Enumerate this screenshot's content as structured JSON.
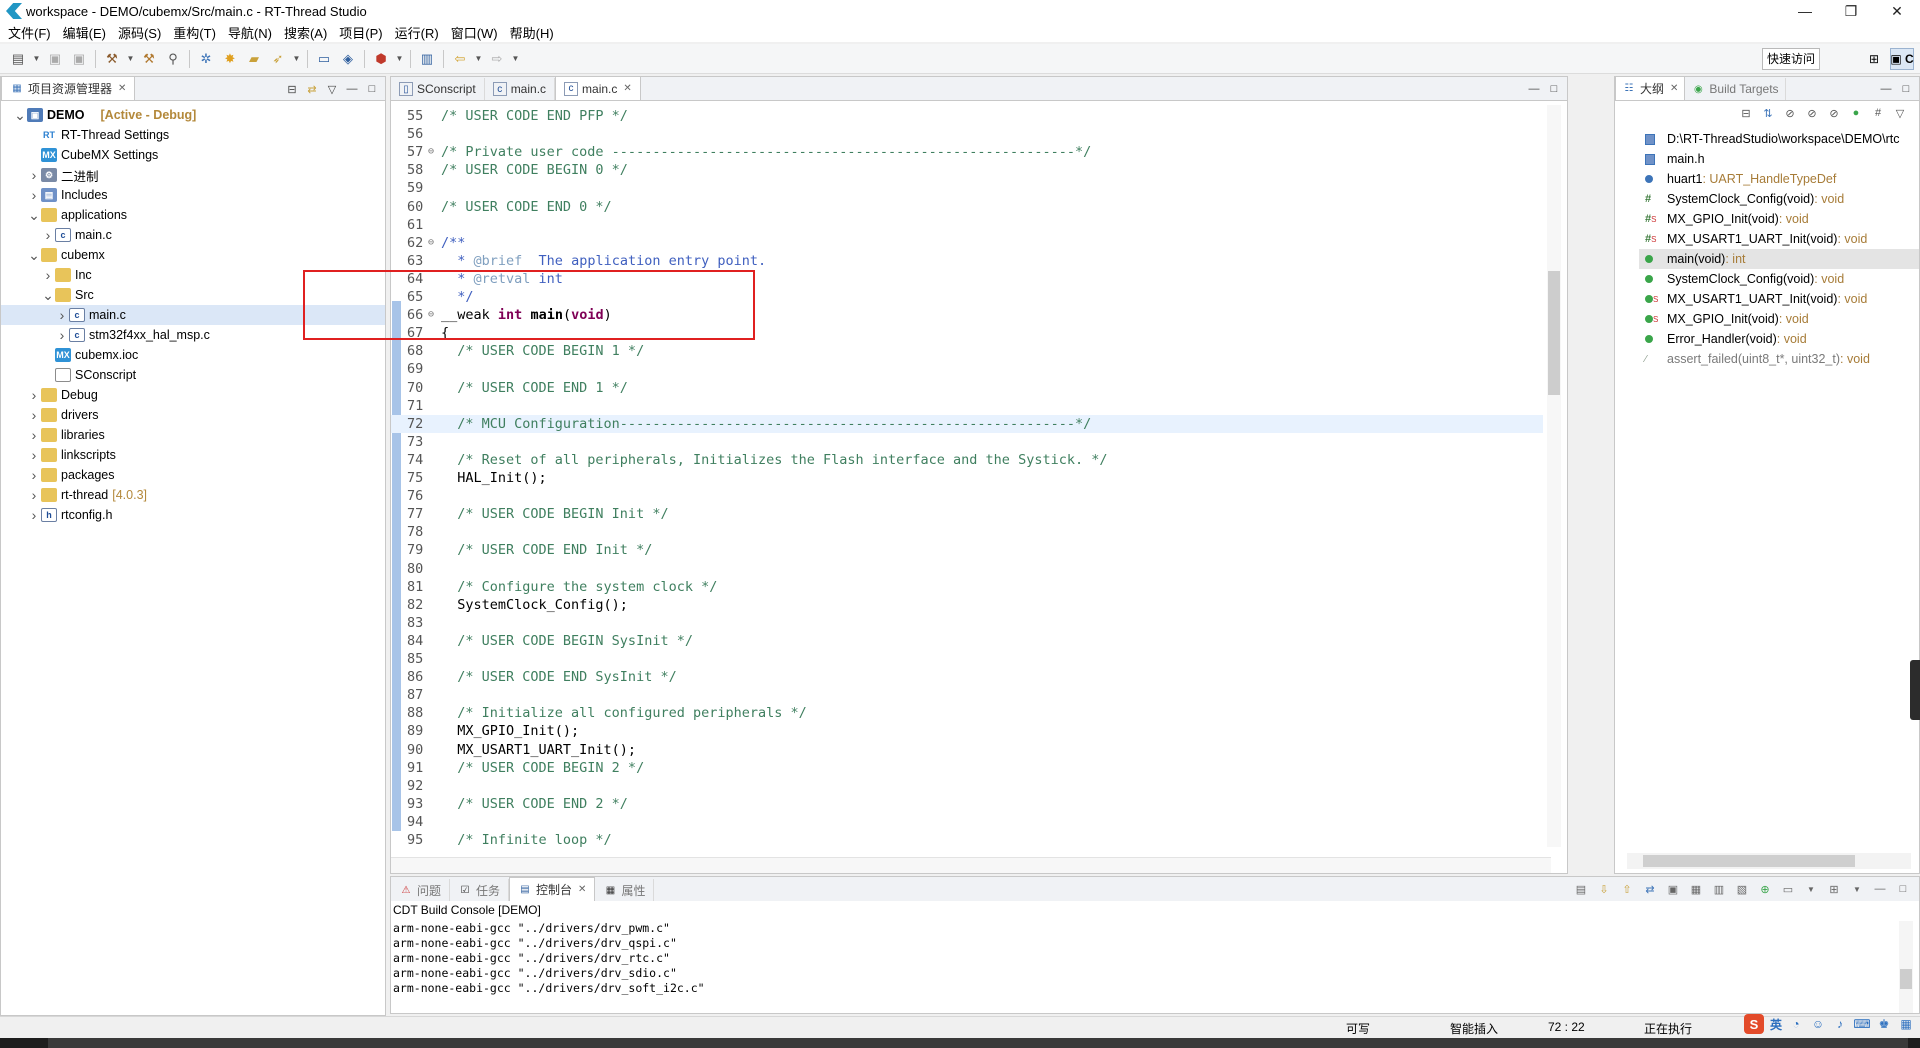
{
  "window": {
    "title": "workspace - DEMO/cubemx/Src/main.c - RT-Thread Studio",
    "controls": [
      "—",
      "❐",
      "✕"
    ]
  },
  "menu": [
    "文件(F)",
    "编辑(E)",
    "源码(S)",
    "重构(T)",
    "导航(N)",
    "搜索(A)",
    "项目(P)",
    "运行(R)",
    "窗口(W)",
    "帮助(H)"
  ],
  "toolbar": {
    "quick_access": "快速访问",
    "perspective_label": "C"
  },
  "project_explorer": {
    "tab_label": "项目资源管理器",
    "items": [
      {
        "label": "DEMO",
        "annotation": "[Active - Debug]",
        "icon": "project-icon",
        "twisty": "v"
      },
      {
        "label": "RT-Thread Settings",
        "icon": "rt-settings-icon",
        "twisty": ""
      },
      {
        "label": "CubeMX Settings",
        "icon": "cubemx-icon",
        "twisty": ""
      },
      {
        "label": "二进制",
        "icon": "binaries-icon",
        "twisty": ">"
      },
      {
        "label": "Includes",
        "icon": "includes-icon",
        "twisty": ">"
      },
      {
        "label": "applications",
        "icon": "folder-icon",
        "twisty": "v"
      },
      {
        "label": "main.c",
        "icon": "c-file-icon",
        "twisty": ">"
      },
      {
        "label": "cubemx",
        "icon": "folder-icon",
        "twisty": "v"
      },
      {
        "label": "Inc",
        "icon": "folder-icon",
        "twisty": ">"
      },
      {
        "label": "Src",
        "icon": "folder-icon",
        "twisty": "v"
      },
      {
        "label": "main.c",
        "icon": "c-file-icon",
        "twisty": ">"
      },
      {
        "label": "stm32f4xx_hal_msp.c",
        "icon": "c-file-icon",
        "twisty": ">"
      },
      {
        "label": "cubemx.ioc",
        "icon": "cubemx-icon",
        "twisty": ""
      },
      {
        "label": "SConscript",
        "icon": "text-file-icon",
        "twisty": ""
      },
      {
        "label": "Debug",
        "icon": "folder-icon",
        "twisty": ">"
      },
      {
        "label": "drivers",
        "icon": "folder-icon",
        "twisty": ">"
      },
      {
        "label": "libraries",
        "icon": "folder-icon",
        "twisty": ">"
      },
      {
        "label": "linkscripts",
        "icon": "folder-icon",
        "twisty": ">"
      },
      {
        "label": "packages",
        "icon": "folder-icon",
        "twisty": ">"
      },
      {
        "label": "rt-thread",
        "version": "[4.0.3]",
        "icon": "folder-icon",
        "twisty": ">"
      },
      {
        "label": "rtconfig.h",
        "icon": "h-file-icon",
        "twisty": ">"
      }
    ]
  },
  "editor": {
    "tabs": [
      {
        "label": "SConscript",
        "icon": "text-file-icon"
      },
      {
        "label": "main.c",
        "icon": "c-file-icon"
      },
      {
        "label": "main.c",
        "icon": "c-file-icon",
        "active": true
      }
    ],
    "lines": [
      {
        "n": "55",
        "segs": [
          [
            "cm",
            "/* USER CODE END PFP */"
          ]
        ]
      },
      {
        "n": "56",
        "segs": []
      },
      {
        "n": "57",
        "fold": "⊖",
        "segs": [
          [
            "cm",
            "/* Private user code ---------------------------------------------------------*/"
          ]
        ]
      },
      {
        "n": "58",
        "segs": [
          [
            "cm",
            "/* USER CODE BEGIN 0 */"
          ]
        ]
      },
      {
        "n": "59",
        "segs": []
      },
      {
        "n": "60",
        "segs": [
          [
            "cm",
            "/* USER CODE END 0 */"
          ]
        ]
      },
      {
        "n": "61",
        "segs": []
      },
      {
        "n": "62",
        "fold": "⊖",
        "segs": [
          [
            "jd",
            "/**"
          ]
        ]
      },
      {
        "n": "63",
        "segs": [
          [
            "jd",
            "  * "
          ],
          [
            "jdt",
            "@brief"
          ],
          [
            "jd",
            "  The application entry point."
          ]
        ]
      },
      {
        "n": "64",
        "segs": [
          [
            "jd",
            "  * "
          ],
          [
            "jdt",
            "@retval"
          ],
          [
            "jd",
            " int"
          ]
        ]
      },
      {
        "n": "65",
        "segs": [
          [
            "jd",
            "  */"
          ]
        ]
      },
      {
        "n": "66",
        "fold": "⊖",
        "segs": [
          [
            "df",
            "__weak "
          ],
          [
            "kw",
            "int"
          ],
          [
            "df",
            " "
          ],
          [
            "fn",
            "main"
          ],
          [
            "df",
            "("
          ],
          [
            "kw",
            "void"
          ],
          [
            "df",
            ")"
          ]
        ]
      },
      {
        "n": "67",
        "segs": [
          [
            "df",
            "{"
          ]
        ]
      },
      {
        "n": "68",
        "segs": [
          [
            "cm",
            "  /* USER CODE BEGIN 1 */"
          ]
        ]
      },
      {
        "n": "69",
        "segs": []
      },
      {
        "n": "70",
        "segs": [
          [
            "cm",
            "  /* USER CODE END 1 */"
          ]
        ]
      },
      {
        "n": "71",
        "segs": []
      },
      {
        "n": "72",
        "hl": true,
        "segs": [
          [
            "cm",
            "  /* MCU Configuration--------------------------------------------------------*/"
          ]
        ]
      },
      {
        "n": "73",
        "segs": []
      },
      {
        "n": "74",
        "segs": [
          [
            "cm",
            "  /* Reset of all peripherals, Initializes the Flash interface and the Systick. */"
          ]
        ]
      },
      {
        "n": "75",
        "segs": [
          [
            "df",
            "  HAL_Init();"
          ]
        ]
      },
      {
        "n": "76",
        "segs": []
      },
      {
        "n": "77",
        "segs": [
          [
            "cm",
            "  /* USER CODE BEGIN Init */"
          ]
        ]
      },
      {
        "n": "78",
        "segs": []
      },
      {
        "n": "79",
        "segs": [
          [
            "cm",
            "  /* USER CODE END Init */"
          ]
        ]
      },
      {
        "n": "80",
        "segs": []
      },
      {
        "n": "81",
        "segs": [
          [
            "cm",
            "  /* Configure the system clock */"
          ]
        ]
      },
      {
        "n": "82",
        "segs": [
          [
            "df",
            "  SystemClock_Config();"
          ]
        ]
      },
      {
        "n": "83",
        "segs": []
      },
      {
        "n": "84",
        "segs": [
          [
            "cm",
            "  /* USER CODE BEGIN SysInit */"
          ]
        ]
      },
      {
        "n": "85",
        "segs": []
      },
      {
        "n": "86",
        "segs": [
          [
            "cm",
            "  /* USER CODE END SysInit */"
          ]
        ]
      },
      {
        "n": "87",
        "segs": []
      },
      {
        "n": "88",
        "segs": [
          [
            "cm",
            "  /* Initialize all configured peripherals */"
          ]
        ]
      },
      {
        "n": "89",
        "segs": [
          [
            "df",
            "  MX_GPIO_Init();"
          ]
        ]
      },
      {
        "n": "90",
        "segs": [
          [
            "df",
            "  MX_USART1_UART_Init();"
          ]
        ]
      },
      {
        "n": "91",
        "segs": [
          [
            "cm",
            "  /* USER CODE BEGIN 2 */"
          ]
        ]
      },
      {
        "n": "92",
        "segs": []
      },
      {
        "n": "93",
        "segs": [
          [
            "cm",
            "  /* USER CODE END 2 */"
          ]
        ]
      },
      {
        "n": "94",
        "segs": []
      },
      {
        "n": "95",
        "segs": [
          [
            "cm",
            "  /* Infinite loop */"
          ]
        ]
      }
    ]
  },
  "outline": {
    "tab_label": "大纲",
    "tab2_label": "Build Targets",
    "items": [
      {
        "name": "D:\\RT-ThreadStudio\\workspace\\DEMO\\rtc",
        "type": "",
        "icon": "include-icon"
      },
      {
        "name": "main.h",
        "type": "",
        "icon": "include-icon"
      },
      {
        "name": "huart1",
        "type": " : UART_HandleTypeDef",
        "icon": "variable-icon"
      },
      {
        "name": "SystemClock_Config(void)",
        "type": " : void",
        "icon": "prototype-icon"
      },
      {
        "name": "MX_GPIO_Init(void)",
        "type": " : void",
        "icon": "static-prototype-icon"
      },
      {
        "name": "MX_USART1_UART_Init(void)",
        "type": " : void",
        "icon": "static-prototype-icon"
      },
      {
        "name": "main(void)",
        "type": " : int",
        "icon": "function-icon",
        "selected": true
      },
      {
        "name": "SystemClock_Config(void)",
        "type": " : void",
        "icon": "function-icon"
      },
      {
        "name": "MX_USART1_UART_Init(void)",
        "type": " : void",
        "icon": "static-function-icon"
      },
      {
        "name": "MX_GPIO_Init(void)",
        "type": " : void",
        "icon": "static-function-icon"
      },
      {
        "name": "Error_Handler(void)",
        "type": " : void",
        "icon": "function-icon"
      },
      {
        "name": "assert_failed(uint8_t*, uint32_t)",
        "type": " : void",
        "icon": "disabled-function-icon",
        "dim": true
      }
    ]
  },
  "console": {
    "tabs": [
      "问题",
      "任务",
      "控制台",
      "属性"
    ],
    "active_tab": "控制台",
    "title": "CDT Build Console [DEMO]",
    "lines": [
      "arm-none-eabi-gcc \"../drivers/drv_pwm.c\"",
      "arm-none-eabi-gcc \"../drivers/drv_qspi.c\"",
      "arm-none-eabi-gcc \"../drivers/drv_rtc.c\"",
      "arm-none-eabi-gcc \"../drivers/drv_sdio.c\"",
      "arm-none-eabi-gcc \"../drivers/drv_soft_i2c.c\""
    ]
  },
  "status": {
    "writable": "可写",
    "insert_mode": "智能插入",
    "position": "72 : 22",
    "running": "正在执行",
    "ime_lang": "英"
  }
}
